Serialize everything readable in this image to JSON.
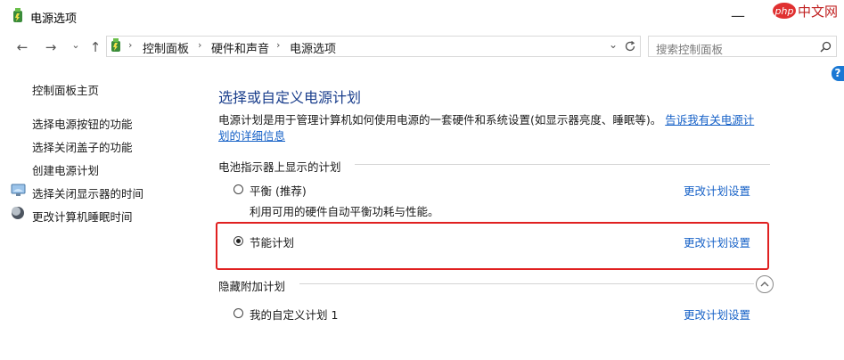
{
  "window": {
    "title": "电源选项",
    "controls": {
      "minimize": "—",
      "close": "✕"
    },
    "watermark": "php中文网"
  },
  "nav": {
    "back": "←",
    "forward": "→",
    "dropdown": "⌄",
    "up": "↑",
    "breadcrumbs": [
      "控制面板",
      "硬件和声音",
      "电源选项"
    ],
    "breadcrumb_sep": "›",
    "search_placeholder": "搜索控制面板"
  },
  "help_label": "?",
  "sidebar": {
    "home": "控制面板主页",
    "links": [
      "选择电源按钮的功能",
      "选择关闭盖子的功能",
      "创建电源计划",
      "选择关闭显示器的时间",
      "更改计算机睡眠时间"
    ]
  },
  "main": {
    "heading": "选择或自定义电源计划",
    "description": "电源计划是用于管理计算机如何使用电源的一套硬件和系统设置(如显示器亮度、睡眠等)。",
    "description_link_line1": "告诉我有关电源计",
    "description_link_line2": "划的详细信息",
    "battery_section": "电池指示器上显示的计划",
    "hidden_section": "隐藏附加计划",
    "plans": [
      {
        "name": "平衡 (推荐)",
        "desc": "利用可用的硬件自动平衡功耗与性能。",
        "selected": false,
        "link": "更改计划设置"
      },
      {
        "name": "节能计划",
        "desc": "",
        "selected": true,
        "link": "更改计划设置"
      },
      {
        "name": "我的自定义计划 1",
        "desc": "",
        "selected": false,
        "link": "更改计划设置"
      }
    ]
  },
  "colors": {
    "heading": "#1a3e8c",
    "link": "#1661c7",
    "highlight": "#e02020"
  }
}
